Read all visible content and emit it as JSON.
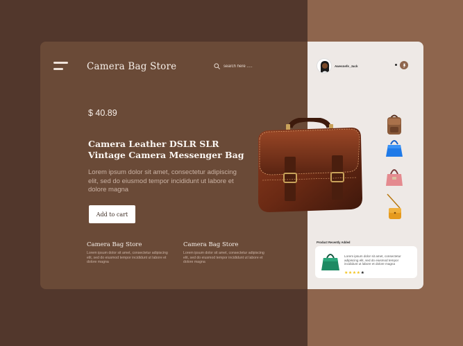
{
  "header": {
    "brand": "Camera Bag Store",
    "search_placeholder": "search here ....."
  },
  "product": {
    "price": "$ 40.89",
    "title": "Camera Leather DSLR  SLR Vintage Camera Messenger Bag",
    "description": "Lorem ipsum dolor sit amet, consectetur adipiscing elit, sed do eiusmod tempor incididunt ut labore et dolore magna",
    "add_to_cart": "Add to cart"
  },
  "info_blocks": [
    {
      "title": "Camera Bag Store",
      "text": "Lorem ipsum dolor sit amet, consectetur adipiscing elit, sed do eiusmod tempor incididunt ut labore et dolore magna"
    },
    {
      "title": "Camera Bag Store",
      "text": "Lorem ipsum dolor sit amet, consectetur adipiscing elit, sed do eiusmod tempor incididunt ut labore et dolore magna"
    }
  ],
  "user": {
    "name": "Awesnefe_Jack"
  },
  "thumbnails": [
    "brown-backpack-icon",
    "blue-handbag-icon",
    "pink-handbag-icon",
    "orange-crossbody-icon"
  ],
  "recent": {
    "label": "Product Recently Added",
    "text": "Lorem ipsum dolor sit amet, consectetur adipiscing elit, sed do eiusmod tempor incididunt ut labore et dolore magna",
    "rating": 4,
    "rating_max": 5
  },
  "colors": {
    "background": "#52372c",
    "panel": "#6a4a37",
    "accent": "#8e654d",
    "star": "#f2c21b"
  }
}
